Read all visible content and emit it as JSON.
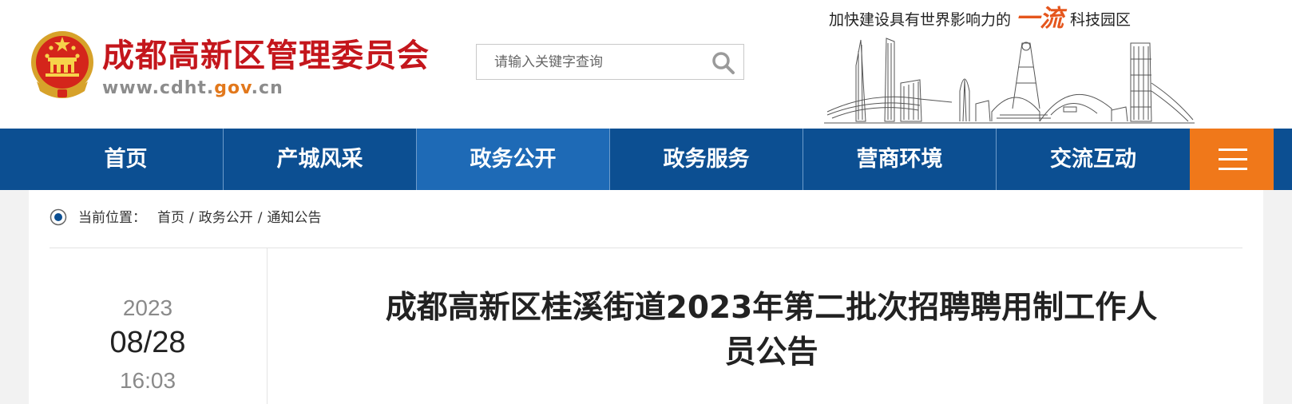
{
  "header": {
    "site_title": "成都高新区管理委员会",
    "site_url_prefix": "www.cdht.",
    "site_url_highlight": "gov",
    "site_url_suffix": ".cn",
    "slogan_before": "加快建设具有世界影响力的",
    "slogan_emphasis": "一流",
    "slogan_after": "科技园区"
  },
  "search": {
    "placeholder": "请输入关键字查询"
  },
  "nav": {
    "items": [
      {
        "label": "首页"
      },
      {
        "label": "产城风采"
      },
      {
        "label": "政务公开"
      },
      {
        "label": "政务服务"
      },
      {
        "label": "营商环境"
      },
      {
        "label": "交流互动"
      }
    ],
    "active": "政务公开"
  },
  "breadcrumb": {
    "label": "当前位置：",
    "items": [
      "首页",
      "政务公开",
      "通知公告"
    ],
    "separator": "/"
  },
  "article": {
    "date_year": "2023",
    "date_month_day": "08/28",
    "date_time": "16:03",
    "title": "成都高新区桂溪街道2023年第二批次招聘聘用制工作人员公告"
  },
  "colors": {
    "brand_red": "#c4161c",
    "nav_blue": "#0c4f92",
    "nav_active": "#1e6ab6",
    "menu_orange": "#f0781a",
    "slogan_orange": "#e5561d"
  },
  "icons": [
    "national-emblem-icon",
    "search-icon",
    "hamburger-menu-icon",
    "location-dot-icon",
    "city-skyline-illustration"
  ]
}
